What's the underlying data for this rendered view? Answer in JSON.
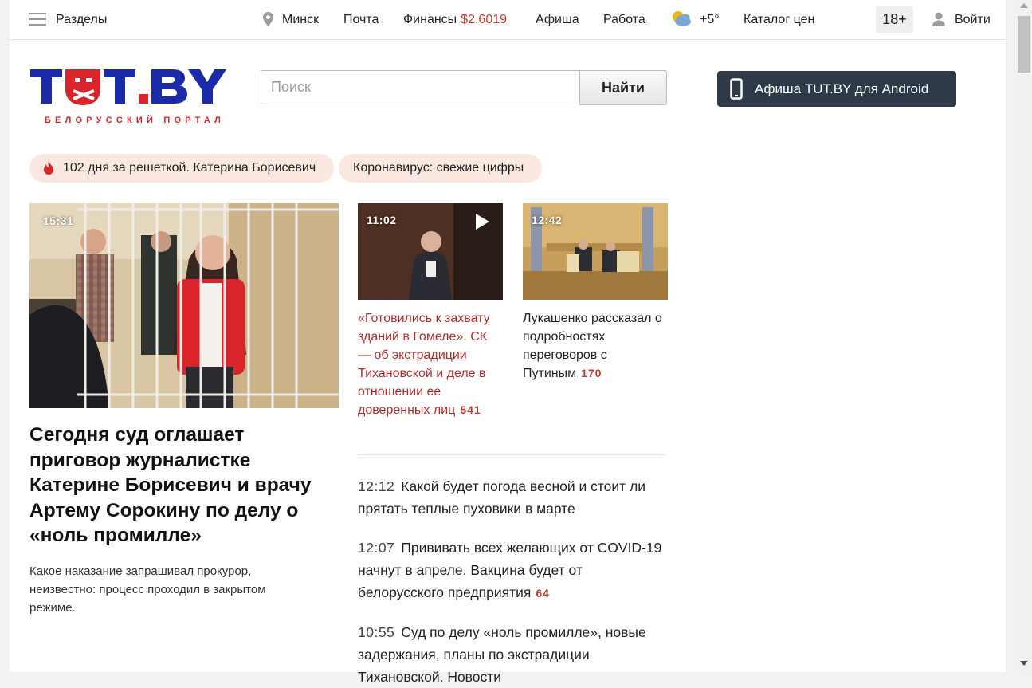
{
  "topbar": {
    "sections_label": "Разделы",
    "city": "Минск",
    "mail": "Почта",
    "finance": "Финансы",
    "finance_value": "$2.6019",
    "afisha": "Афиша",
    "work": "Работа",
    "temperature": "+5°",
    "catalog": "Каталог цен",
    "age": "18+",
    "login": "Войти"
  },
  "header": {
    "logo_text": "TUT.BY",
    "logo_sub": "БЕЛОРУССКИЙ ПОРТАЛ",
    "search_placeholder": "Поиск",
    "search_button": "Найти",
    "android_button": "Афиша TUT.BY для Android"
  },
  "tags": [
    {
      "label": "102 дня за решеткой. Катерина Борисевич"
    },
    {
      "label": "Коронавирус: свежие цифры"
    }
  ],
  "main_story": {
    "time": "15:31",
    "title": "Сегодня суд оглашает приговор журналистке Катерине Борисевич и врачу Артему Сорокину по делу о «ноль промилле»",
    "lead": "Какое наказание запрашивал прокурор, неизвестно: процесс проходил в закрытом режиме."
  },
  "cards": [
    {
      "time": "11:02",
      "title": "«Готовились к захвату зданий в Гомеле». СК — об экстрадиции Тихановской и деле в отношении ее доверенных лиц",
      "count": "541",
      "title_color": "#b72a2a"
    },
    {
      "time": "12:42",
      "title": "Лукашенко рассказал о подробностях переговоров с Путиным",
      "count": "170",
      "title_color": "#222222"
    }
  ],
  "news": [
    {
      "time": "12:12",
      "title": "Какой будет погода весной и стоит ли прятать теплые пуховики в марте",
      "count": ""
    },
    {
      "time": "12:07",
      "title": "Прививать всех желающих от COVID-19 начнут в апреле. Вакцина будет от белорусского предприятия",
      "count": "64"
    },
    {
      "time": "10:55",
      "title": "Суд по делу «ноль промилле», новые задержания, планы по экстрадиции Тихановской. Новости",
      "count": ""
    }
  ],
  "colors": {
    "accent_red": "#c0392b",
    "logo_blue": "#1a2aa8",
    "logo_red": "#d9252a",
    "android_bg": "#2e3a48",
    "tag_bg": "#fbe9e1"
  },
  "icons": [
    "menu-icon",
    "location-pin-icon",
    "weather-cloud-sun-icon",
    "user-icon",
    "fire-icon",
    "play-icon",
    "phone-icon"
  ]
}
